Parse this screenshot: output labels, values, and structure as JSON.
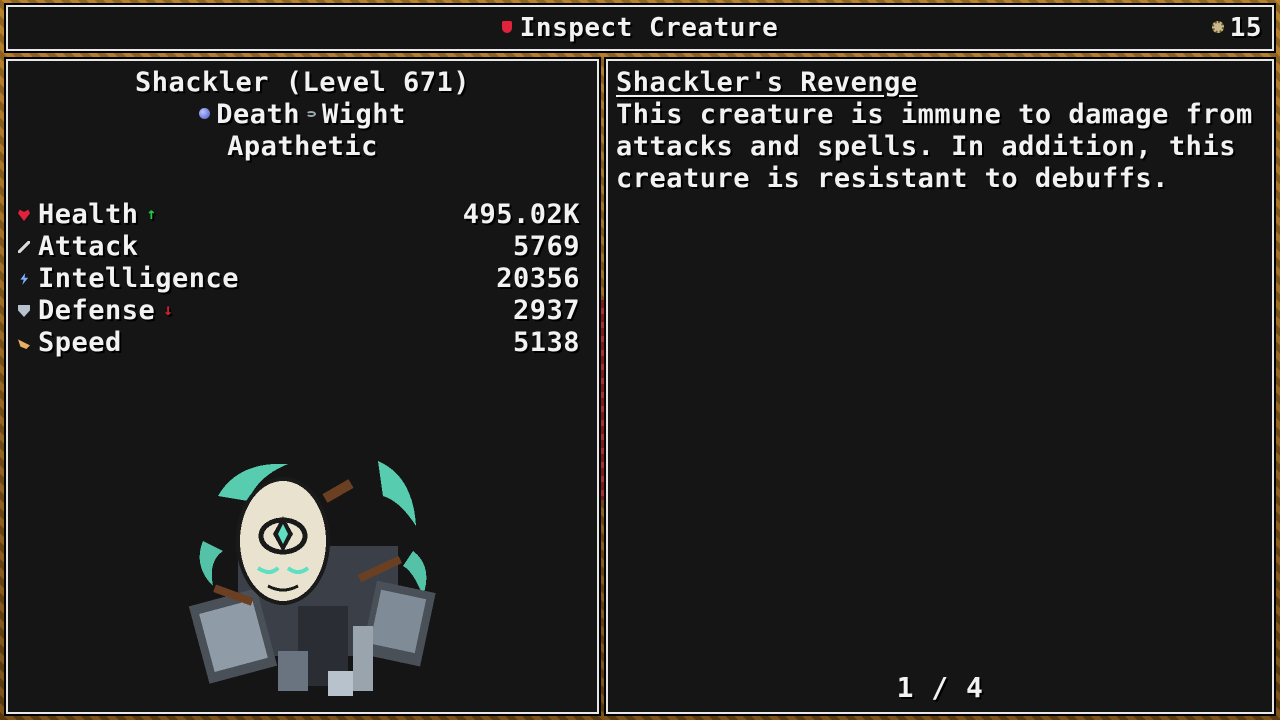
{
  "header": {
    "title": "Inspect Creature",
    "currency_count": "15"
  },
  "creature": {
    "name_level": "Shackler (Level 671)",
    "type_primary": "Death",
    "type_secondary": "Wight",
    "trait": "Apathetic",
    "stats": [
      {
        "name": "Health",
        "value": "495.02K",
        "icon": "heart-icon",
        "modifier": "up"
      },
      {
        "name": "Attack",
        "value": "5769",
        "icon": "sword-icon",
        "modifier": ""
      },
      {
        "name": "Intelligence",
        "value": "20356",
        "icon": "bolt-icon",
        "modifier": ""
      },
      {
        "name": "Defense",
        "value": "2937",
        "icon": "shield-icon",
        "modifier": "down"
      },
      {
        "name": "Speed",
        "value": "5138",
        "icon": "wing-icon",
        "modifier": ""
      }
    ]
  },
  "ability": {
    "name": "Shackler's Revenge",
    "description": "This creature is immune to damage from attacks and spells. In addition, this creature is resistant to debuffs.",
    "page": "1 / 4"
  },
  "colors": {
    "panel_bg": "#151515",
    "border": "#e8e8e8",
    "stat_up": "#22c84a",
    "stat_down": "#d81e2e",
    "accent_red": "#e0223a"
  }
}
